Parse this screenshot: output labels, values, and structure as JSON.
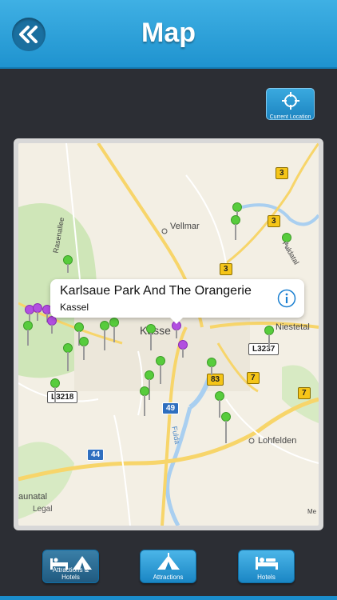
{
  "header": {
    "title": "Map"
  },
  "location_button": {
    "label": "Current Location"
  },
  "map": {
    "labels": {
      "vellmar": "Vellmar",
      "lohfelden": "Lohfelden",
      "niestetal": "Niestetal",
      "rasenallee": "Rasenallee",
      "kassel": "Kasse",
      "baunatal": "aunatal",
      "fulda": "Fulda",
      "fuldatal": "Fuldatal",
      "me": "Me"
    },
    "roads": {
      "r3a": "3",
      "r3b": "3",
      "r3c": "3",
      "r7a": "7",
      "r7b": "7",
      "r83": "83",
      "r49": "49",
      "r44": "44",
      "l3218": "L3218",
      "l3237": "L3237"
    },
    "callout": {
      "title": "Karlsaue Park And The Orangerie",
      "subtitle": "Kassel"
    },
    "legal": "Legal"
  },
  "tabs": {
    "attractions_hotels": "Attractions & Hotels",
    "attractions": "Attractions",
    "hotels": "Hotels"
  }
}
